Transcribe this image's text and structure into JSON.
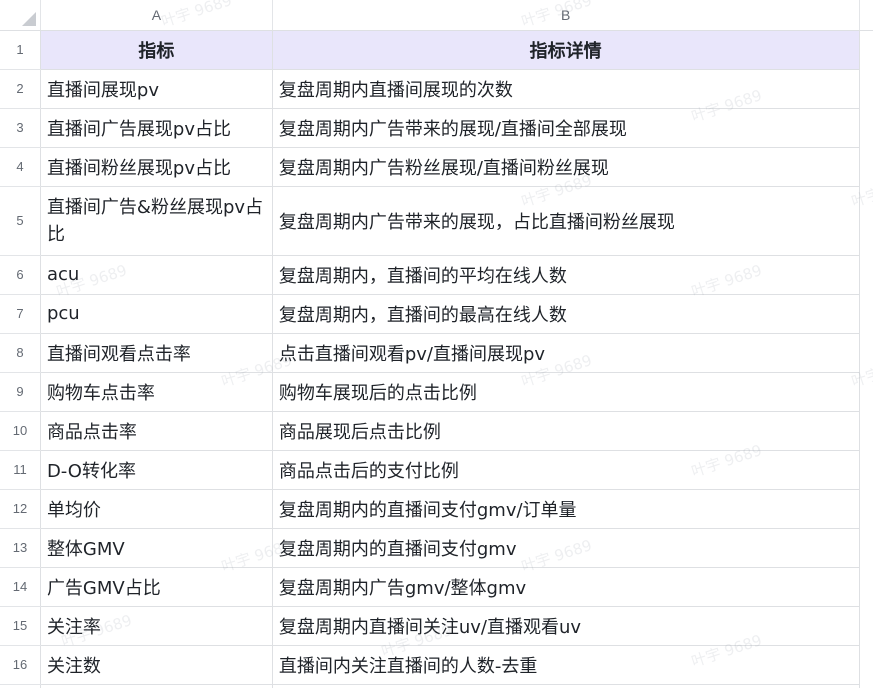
{
  "columns": [
    "A",
    "B"
  ],
  "header": {
    "row": "1",
    "a": "指标",
    "b": "指标详情"
  },
  "rows": [
    {
      "num": "2",
      "a": "直播间展现pv",
      "b": "复盘周期内直播间展现的次数"
    },
    {
      "num": "3",
      "a": "直播间广告展现pv占比",
      "b": "复盘周期内广告带来的展现/直播间全部展现"
    },
    {
      "num": "4",
      "a": "直播间粉丝展现pv占比",
      "b": "复盘周期内广告粉丝展现/直播间粉丝展现"
    },
    {
      "num": "5",
      "a": "直播间广告&粉丝展现pv占比",
      "b": "复盘周期内广告带来的展现，占比直播间粉丝展现"
    },
    {
      "num": "6",
      "a": "acu",
      "b": "复盘周期内，直播间的平均在线人数"
    },
    {
      "num": "7",
      "a": "pcu",
      "b": "复盘周期内，直播间的最高在线人数"
    },
    {
      "num": "8",
      "a": "直播间观看点击率",
      "b": "点击直播间观看pv/直播间展现pv"
    },
    {
      "num": "9",
      "a": "购物车点击率",
      "b": "购物车展现后的点击比例"
    },
    {
      "num": "10",
      "a": "商品点击率",
      "b": "商品展现后点击比例"
    },
    {
      "num": "11",
      "a": "D-O转化率",
      "b": "商品点击后的支付比例"
    },
    {
      "num": "12",
      "a": "单均价",
      "b": "复盘周期内的直播间支付gmv/订单量"
    },
    {
      "num": "13",
      "a": "整体GMV",
      "b": "复盘周期内的直播间支付gmv"
    },
    {
      "num": "14",
      "a": "广告GMV占比",
      "b": "复盘周期内广告gmv/整体gmv"
    },
    {
      "num": "15",
      "a": "关注率",
      "b": "复盘周期内直播间关注uv/直播观看uv"
    },
    {
      "num": "16",
      "a": "关注数",
      "b": "直播间内关注直播间的人数-去重"
    }
  ],
  "watermark": "叶宇 9689",
  "colors": {
    "header_fill": "#e9e6fb",
    "grid_line": "#dee0e3",
    "text": "#1f2329",
    "header_text_muted": "#646a73"
  }
}
